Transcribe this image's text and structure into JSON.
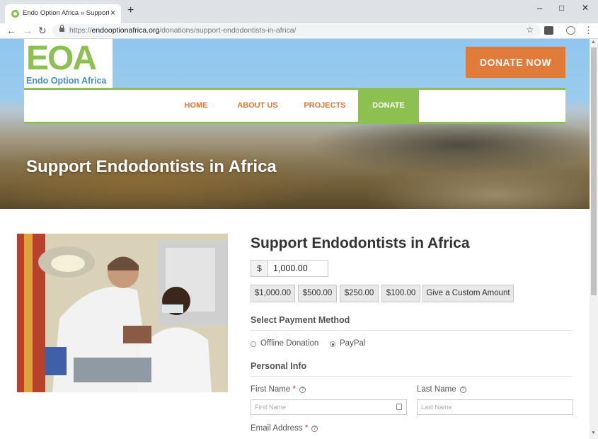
{
  "browser": {
    "tab_title": "Endo Option Africa » Support Endo",
    "tab_close": "×",
    "new_tab": "+",
    "url_scheme": "https://",
    "url_host": "endooptionafrica.org",
    "url_path": "/donations/support-endodontists-in-africa/",
    "controls": {
      "minimize": "–",
      "maximize": "□",
      "close": "✕"
    },
    "nav": {
      "back": "←",
      "forward": "→",
      "reload": "↻"
    },
    "menu": "⋮"
  },
  "site": {
    "logo_letters": "EOA",
    "logo_text": "Endo Option Africa",
    "donate_button": "DONATE NOW",
    "nav": [
      "HOME",
      "ABOUT US",
      "PROJECTS",
      "DONATE"
    ],
    "hero_title": "Support Endodontists in Africa"
  },
  "form": {
    "title": "Support Endodontists in Africa",
    "currency_symbol": "$",
    "amount": "1,000.00",
    "preset_amounts": [
      "$1,000.00",
      "$500.00",
      "$250.00",
      "$100.00",
      "Give a Custom Amount"
    ],
    "payment_section": "Select Payment Method",
    "payment_options": [
      "Offline Donation",
      "PayPal"
    ],
    "selected_payment": "PayPal",
    "personal_section": "Personal Info",
    "first_name_label": "First Name",
    "first_name_placeholder": "First Name",
    "last_name_label": "Last Name",
    "last_name_placeholder": "Last Name",
    "email_label": "Email Address",
    "required_mark": "*",
    "help_mark": "?"
  },
  "colors": {
    "brand_green": "#8cc152",
    "brand_orange": "#e07b39",
    "logo_blue": "#4a90c2"
  }
}
